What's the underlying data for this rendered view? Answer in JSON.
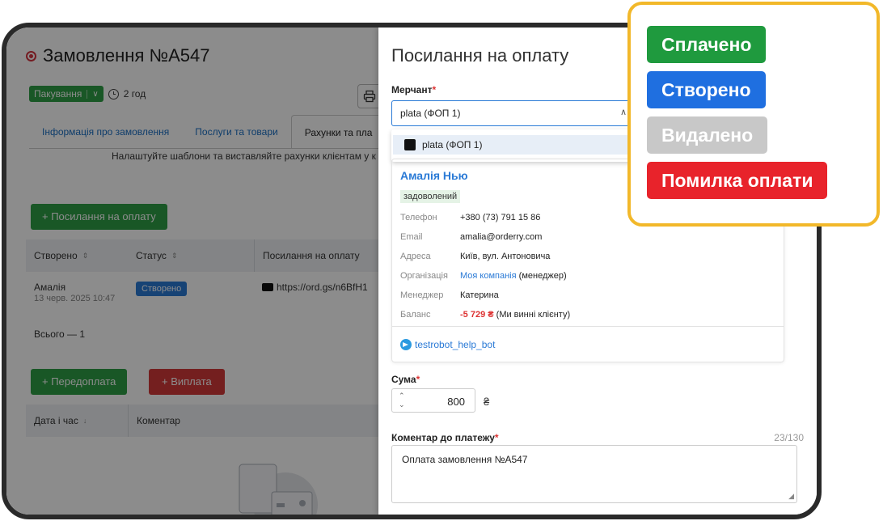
{
  "order": {
    "title": "Замовлення №A547",
    "status": "Пакування",
    "status_caret": "∨",
    "time": "2 год",
    "print_icon": "print-icon"
  },
  "tabs": [
    {
      "label": "Інформація про замовлення",
      "active": false
    },
    {
      "label": "Послуги та товари",
      "active": false
    },
    {
      "label": "Рахунки та пла",
      "active": true
    }
  ],
  "hint": "Налаштуйте шаблони та виставляйте рахунки клієнтам у к",
  "buttons": {
    "payment_link": "+  Посилання на оплату",
    "prepayment": "+  Передоплата",
    "payout": "+  Виплата"
  },
  "payments_table": {
    "headers": [
      "Створено",
      "Статус",
      "Посилання на оплату"
    ],
    "row": {
      "name": "Амалія",
      "date": "13 черв. 2025 10:47",
      "status": "Створено",
      "link": "https://ord.gs/n6BfH1"
    },
    "total": "Всього — 1"
  },
  "history_table": {
    "headers": [
      "Дата і час",
      "Коментар"
    ]
  },
  "drawer": {
    "title": "Посилання на оплату",
    "merchant_label": "Мерчант",
    "merchant_value": "plata (ФОП 1)",
    "merchant_option": "plata (ФОП 1)",
    "client": {
      "name": "Амалія Нью",
      "badge": "задоволений",
      "phone_k": "Телефон",
      "phone_v": "+380 (73) 791 15 86",
      "email_k": "Email",
      "email_v": "amalia@orderry.com",
      "address_k": "Адреса",
      "address_v": "Київ, вул. Антоновича",
      "org_k": "Організація",
      "org_link": "Моя компанія",
      "org_role": " (менеджер)",
      "manager_k": "Менеджер",
      "manager_v": "Катерина",
      "balance_k": "Баланс",
      "balance_amount": "-5 729 ₴",
      "balance_note": " (Ми винні клієнту)",
      "telegram": "testrobot_help_bot"
    },
    "sum_label": "Сума",
    "sum_value": "800",
    "currency": "₴",
    "comment_label": "Коментар до платежу",
    "comment_counter": "23/130",
    "comment_value": "Оплата замовлення №A547"
  },
  "legend": [
    {
      "label": "Сплачено",
      "color": "#1f9a3e"
    },
    {
      "label": "Створено",
      "color": "#1f6fe0"
    },
    {
      "label": "Видалено",
      "color": "#c8c8c8"
    },
    {
      "label": "Помилка оплати",
      "color": "#e8232b"
    }
  ]
}
